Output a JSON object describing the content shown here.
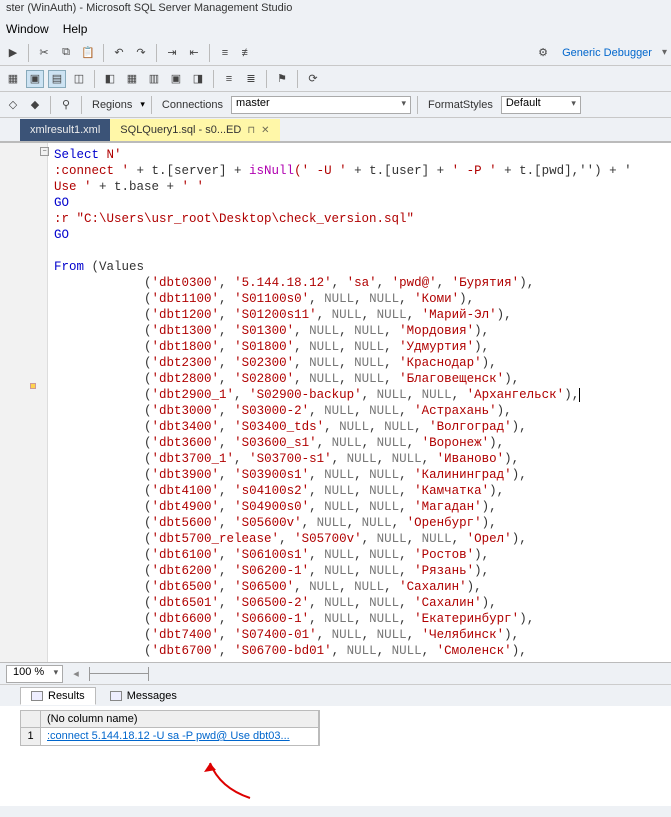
{
  "title": "ster (WinAuth) - Microsoft SQL Server Management Studio",
  "menubar": {
    "window": "Window",
    "help": "Help"
  },
  "toolbar": {
    "debugger_label": "Generic Debugger",
    "regions": "Regions",
    "connections": "Connections",
    "master": "master",
    "formatstyles": "FormatStyles",
    "default_style": "Default"
  },
  "tabs": {
    "inactive": "xmlresult1.xml",
    "active": "SQLQuery1.sql - s0...ED"
  },
  "zoom": "100 %",
  "result_tabs": {
    "results": "Results",
    "messages": "Messages"
  },
  "grid": {
    "column": "(No column name)",
    "rownum": "1",
    "value": ":connect 5.144.18.12 -U sa -P pwd@ Use dbt03..."
  },
  "sql": {
    "select": "Select",
    "nlit": " N'",
    "connect_pre": ":connect ",
    "server_expr": " + t.[server] + ",
    "isnull": "isNull",
    "u_lit": "(' -U '",
    "user_expr": " + t.[user] + ",
    "p_lit": "' -P '",
    "pwd_expr": " + t.[pwd],'')",
    "plus_lit": " + '",
    "use_lit": "Use '",
    "base_expr": " + t.base + ",
    "space_lit": "' '",
    "go1": "GO",
    "r_line": ":r \"C:\\Users\\usr_root\\Desktop\\check_version.sql\"",
    "go2": "GO",
    "from": "From",
    "values": " (Values",
    "null": "NULL",
    "rows": [
      [
        "'dbt0300'",
        "'5.144.18.12'",
        "'sa'",
        "'pwd@'",
        "'Бурятия'"
      ],
      [
        "'dbt1100'",
        "'S01100s0'",
        "NULL",
        "NULL",
        "'Коми'"
      ],
      [
        "'dbt1200'",
        "'S01200s11'",
        "NULL",
        "NULL",
        "'Марий-Эл'"
      ],
      [
        "'dbt1300'",
        "'S01300'",
        "NULL",
        "NULL",
        "'Мордовия'"
      ],
      [
        "'dbt1800'",
        "'S01800'",
        "NULL",
        "NULL",
        "'Удмуртия'"
      ],
      [
        "'dbt2300'",
        "'S02300'",
        "NULL",
        "NULL",
        "'Краснодар'"
      ],
      [
        "'dbt2800'",
        "'S02800'",
        "NULL",
        "NULL",
        "'Благовещенск'"
      ],
      [
        "'dbt2900_1'",
        "'S02900-backup'",
        "NULL",
        "NULL",
        "'Архангельск'"
      ],
      [
        "'dbt3000'",
        "'S03000-2'",
        "NULL",
        "NULL",
        "'Астрахань'"
      ],
      [
        "'dbt3400'",
        "'S03400_tds'",
        "NULL",
        "NULL",
        "'Волгоград'"
      ],
      [
        "'dbt3600'",
        "'S03600_s1'",
        "NULL",
        "NULL",
        "'Воронеж'"
      ],
      [
        "'dbt3700_1'",
        "'S03700-s1'",
        "NULL",
        "NULL",
        "'Иваново'"
      ],
      [
        "'dbt3900'",
        "'S03900s1'",
        "NULL",
        "NULL",
        "'Калининград'"
      ],
      [
        "'dbt4100'",
        "'s04100s2'",
        "NULL",
        "NULL",
        "'Камчатка'"
      ],
      [
        "'dbt4900'",
        "'S04900s0'",
        "NULL",
        "NULL",
        "'Магадан'"
      ],
      [
        "'dbt5600'",
        "'S05600v'",
        "NULL",
        "NULL",
        "'Оренбург'"
      ],
      [
        "'dbt5700_release'",
        "'S05700v'",
        "NULL",
        "NULL",
        "'Орел'"
      ],
      [
        "'dbt6100'",
        "'S06100s1'",
        "NULL",
        "NULL",
        "'Ростов'"
      ],
      [
        "'dbt6200'",
        "'S06200-1'",
        "NULL",
        "NULL",
        "'Рязань'"
      ],
      [
        "'dbt6500'",
        "'S06500'",
        "NULL",
        "NULL",
        "'Сахалин'"
      ],
      [
        "'dbt6501'",
        "'S06500-2'",
        "NULL",
        "NULL",
        "'Сахалин'"
      ],
      [
        "'dbt6600'",
        "'S06600-1'",
        "NULL",
        "NULL",
        "'Екатеринбург'"
      ],
      [
        "'dbt7400'",
        "'S07400-01'",
        "NULL",
        "NULL",
        "'Челябинск'"
      ],
      [
        "'dbt6700'",
        "'S06700-bd01'",
        "NULL",
        "NULL",
        "'Смоленск'"
      ]
    ]
  }
}
